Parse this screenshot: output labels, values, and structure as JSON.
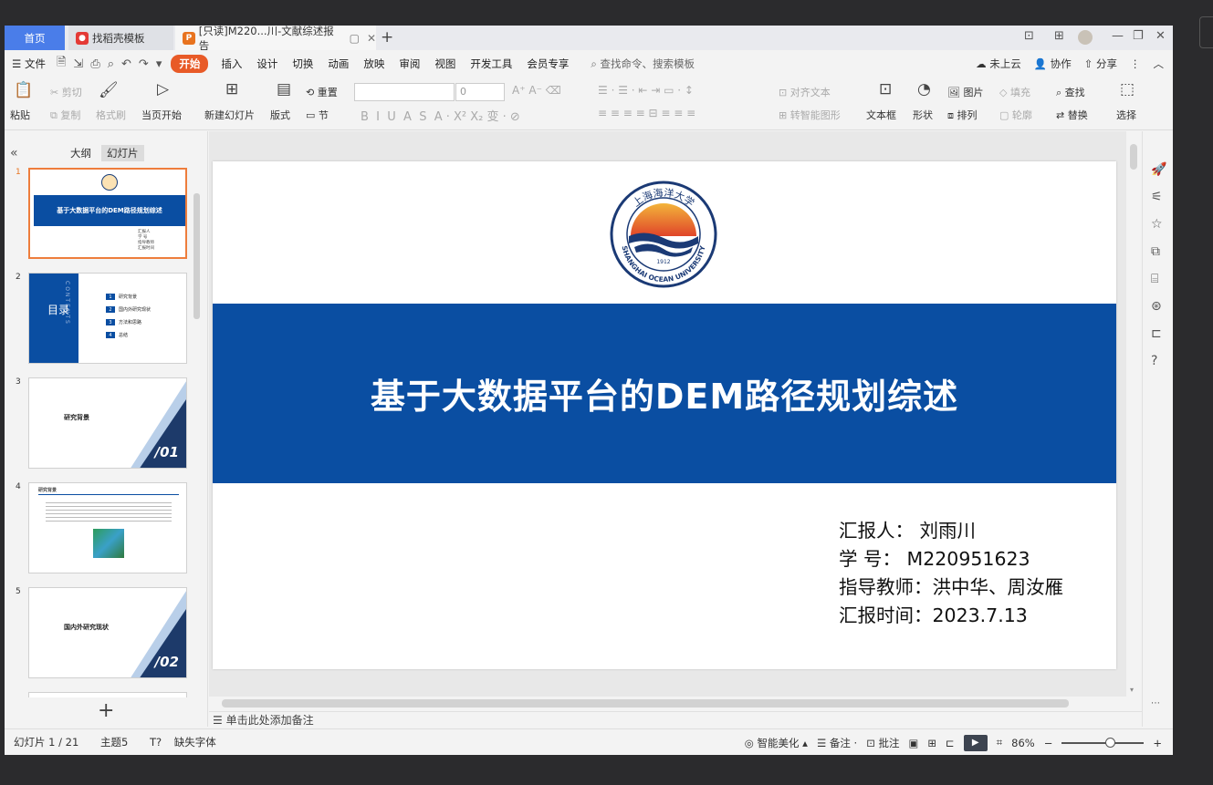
{
  "tabs": {
    "home": "首页",
    "template": "找稻壳模板",
    "document": "[只读]M220...川-文献综述报告"
  },
  "menu": {
    "file": "文件",
    "items": [
      "开始",
      "插入",
      "设计",
      "切换",
      "动画",
      "放映",
      "审阅",
      "视图",
      "开发工具",
      "会员专享"
    ],
    "search": "查找命令、搜索模板",
    "cloud": "未上云",
    "collab": "协作",
    "share": "分享"
  },
  "ribbon": {
    "paste": "粘贴",
    "cut": "剪切",
    "copy": "复制",
    "format_painter": "格式刷",
    "from_current": "当页开始",
    "new_slide": "新建幻灯片",
    "layout": "版式",
    "section": "节",
    "reset": "重置",
    "font_size": "0",
    "align_text": "对齐文本",
    "to_smartart": "转智能图形",
    "textbox": "文本框",
    "shape": "形状",
    "picture": "图片",
    "fill": "填充",
    "arrange": "排列",
    "outline": "轮廓",
    "find": "查找",
    "replace": "替换",
    "select": "选择"
  },
  "left_panel": {
    "outline_tab": "大纲",
    "slides_tab": "幻灯片",
    "thumbs": [
      {
        "num": "1",
        "title": "基于大数据平台的DEM路径规划综述"
      },
      {
        "num": "2",
        "title": "目录",
        "side_text": "CONTENTS",
        "items": [
          "研究背景",
          "国内外研究现状",
          "方法和思路",
          "总结"
        ]
      },
      {
        "num": "3",
        "title": "研究背景",
        "section": "/01"
      },
      {
        "num": "4",
        "title": "研究背景"
      },
      {
        "num": "5",
        "title": "国内外研究现状",
        "section": "/02"
      }
    ]
  },
  "slide": {
    "title": "基于大数据平台的DEM路径规划综述",
    "logo_text": "SHANGHAI OCEAN UNIVERSITY",
    "logo_year": "1912",
    "logo_cn": "上海海洋大学",
    "reporter": "汇报人： 刘雨川",
    "student_id": "学 号： M220951623",
    "advisor": "指导教师：洪中华、周汝雁",
    "date": "汇报时间：2023.7.13"
  },
  "notes_placeholder": "单击此处添加备注",
  "status": {
    "slide_count": "幻灯片 1 / 21",
    "theme": "主题5",
    "missing_font": "缺失字体",
    "beautify": "智能美化",
    "notes": "备注",
    "comment": "批注",
    "zoom": "86%"
  },
  "colors": {
    "brand_blue": "#0a4ea2",
    "accent_orange": "#e85a27"
  }
}
